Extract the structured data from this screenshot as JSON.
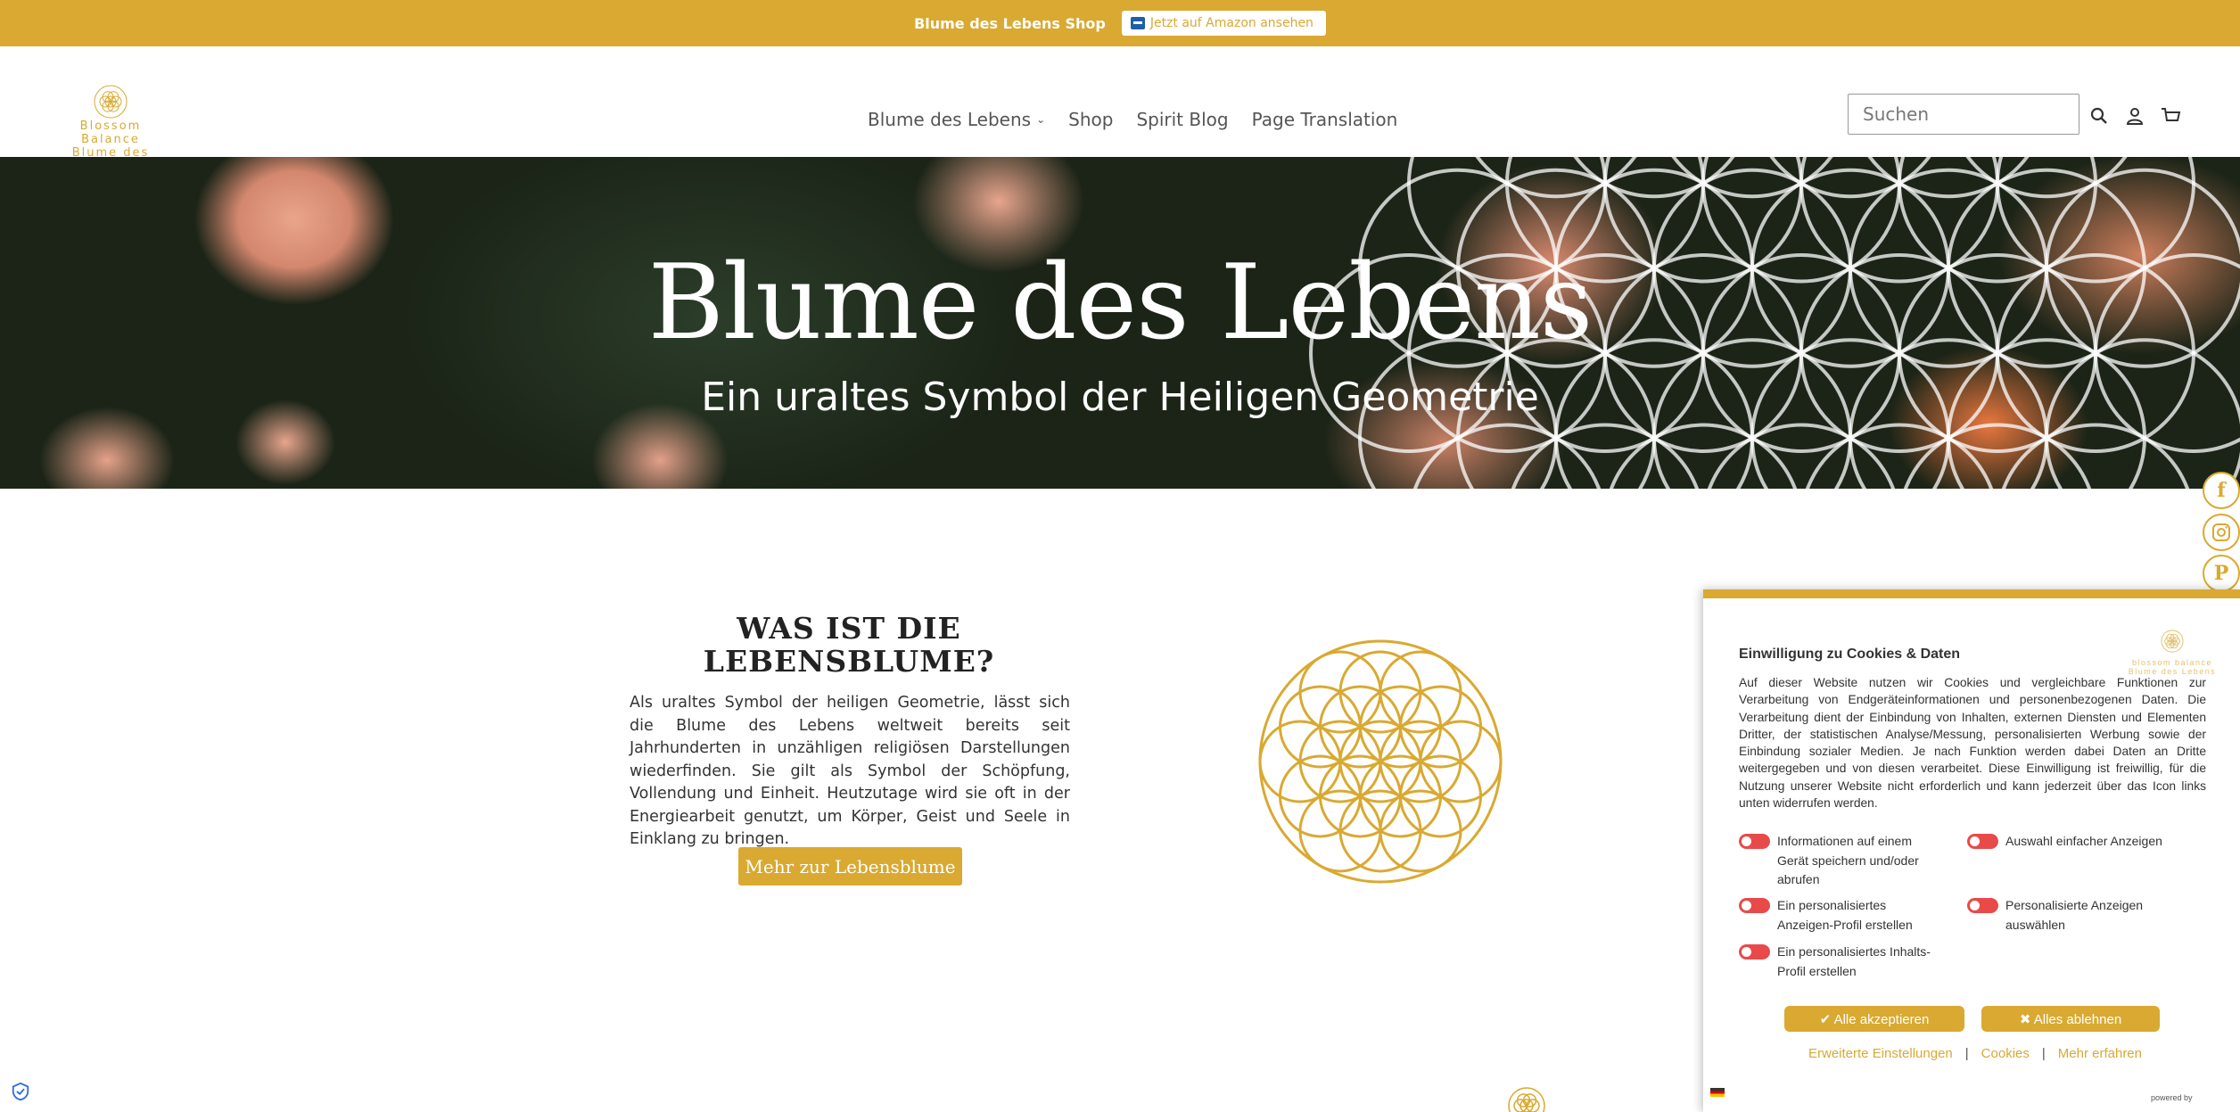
{
  "topbar": {
    "text": "Blume des Lebens Shop",
    "amazon_button": "Jetzt auf Amazon ansehen"
  },
  "header": {
    "logo_line1": "Blossom Balance",
    "logo_line2": "Blume des Lebens",
    "nav": [
      "Blume des Lebens",
      "Shop",
      "Spirit Blog",
      "Page Translation"
    ],
    "search_placeholder": "Suchen"
  },
  "hero": {
    "title": "Blume des Lebens",
    "subtitle": "Ein uraltes Symbol der Heiligen Geometrie"
  },
  "section": {
    "title_line1": "WAS IST DIE",
    "title_line2": "LEBENSBLUME?",
    "body": "Als uraltes Symbol der heiligen Geometrie, lässt sich die Blume des Lebens weltweit bereits seit Jahrhunderten in unzähligen religiösen Darstellungen wiederfinden. Sie gilt als Symbol der Schöpfung, Vollendung und Einheit. Heutzutage wird sie oft in der Energiearbeit genutzt, um Körper, Geist und Seele in Einklang zu bringen.",
    "button": "Mehr zur Lebensblume"
  },
  "social": [
    "f",
    "instagram",
    "P",
    "hand"
  ],
  "cookie": {
    "title": "Einwilligung zu Cookies & Daten",
    "logo_line1": "blossom balance",
    "logo_line2": "Blume des Lebens",
    "text": "Auf dieser Website nutzen wir Cookies und vergleichbare Funktionen zur Verarbeitung von Endgeräteinformationen und personenbezogenen Daten. Die Verarbeitung dient der Einbindung von Inhalten, externen Diensten und Elementen Dritter, der statistischen Analyse/Messung, personalisierten Werbung sowie der Einbindung sozialer Medien. Je nach Funktion werden dabei Daten an Dritte weitergegeben und von diesen verarbeitet. Diese Einwilligung ist freiwillig, für die Nutzung unserer Website nicht erforderlich und kann jederzeit über das Icon links unten widerrufen werden.",
    "options": [
      "Informationen auf einem Gerät speichern und/oder abrufen",
      "Auswahl einfacher Anzeigen",
      "Ein personalisiertes Anzeigen-Profil erstellen",
      "Personalisierte Anzeigen auswählen",
      "Ein personalisiertes Inhalts-Profil erstellen"
    ],
    "accept": "Alle akzeptieren",
    "reject": "Alles ablehnen",
    "links": [
      "Erweiterte Einstellungen",
      "Cookies",
      "Mehr erfahren"
    ],
    "powered": "powered by"
  },
  "colors": {
    "accent": "#d9a931",
    "toggle": "#e84a4a"
  }
}
